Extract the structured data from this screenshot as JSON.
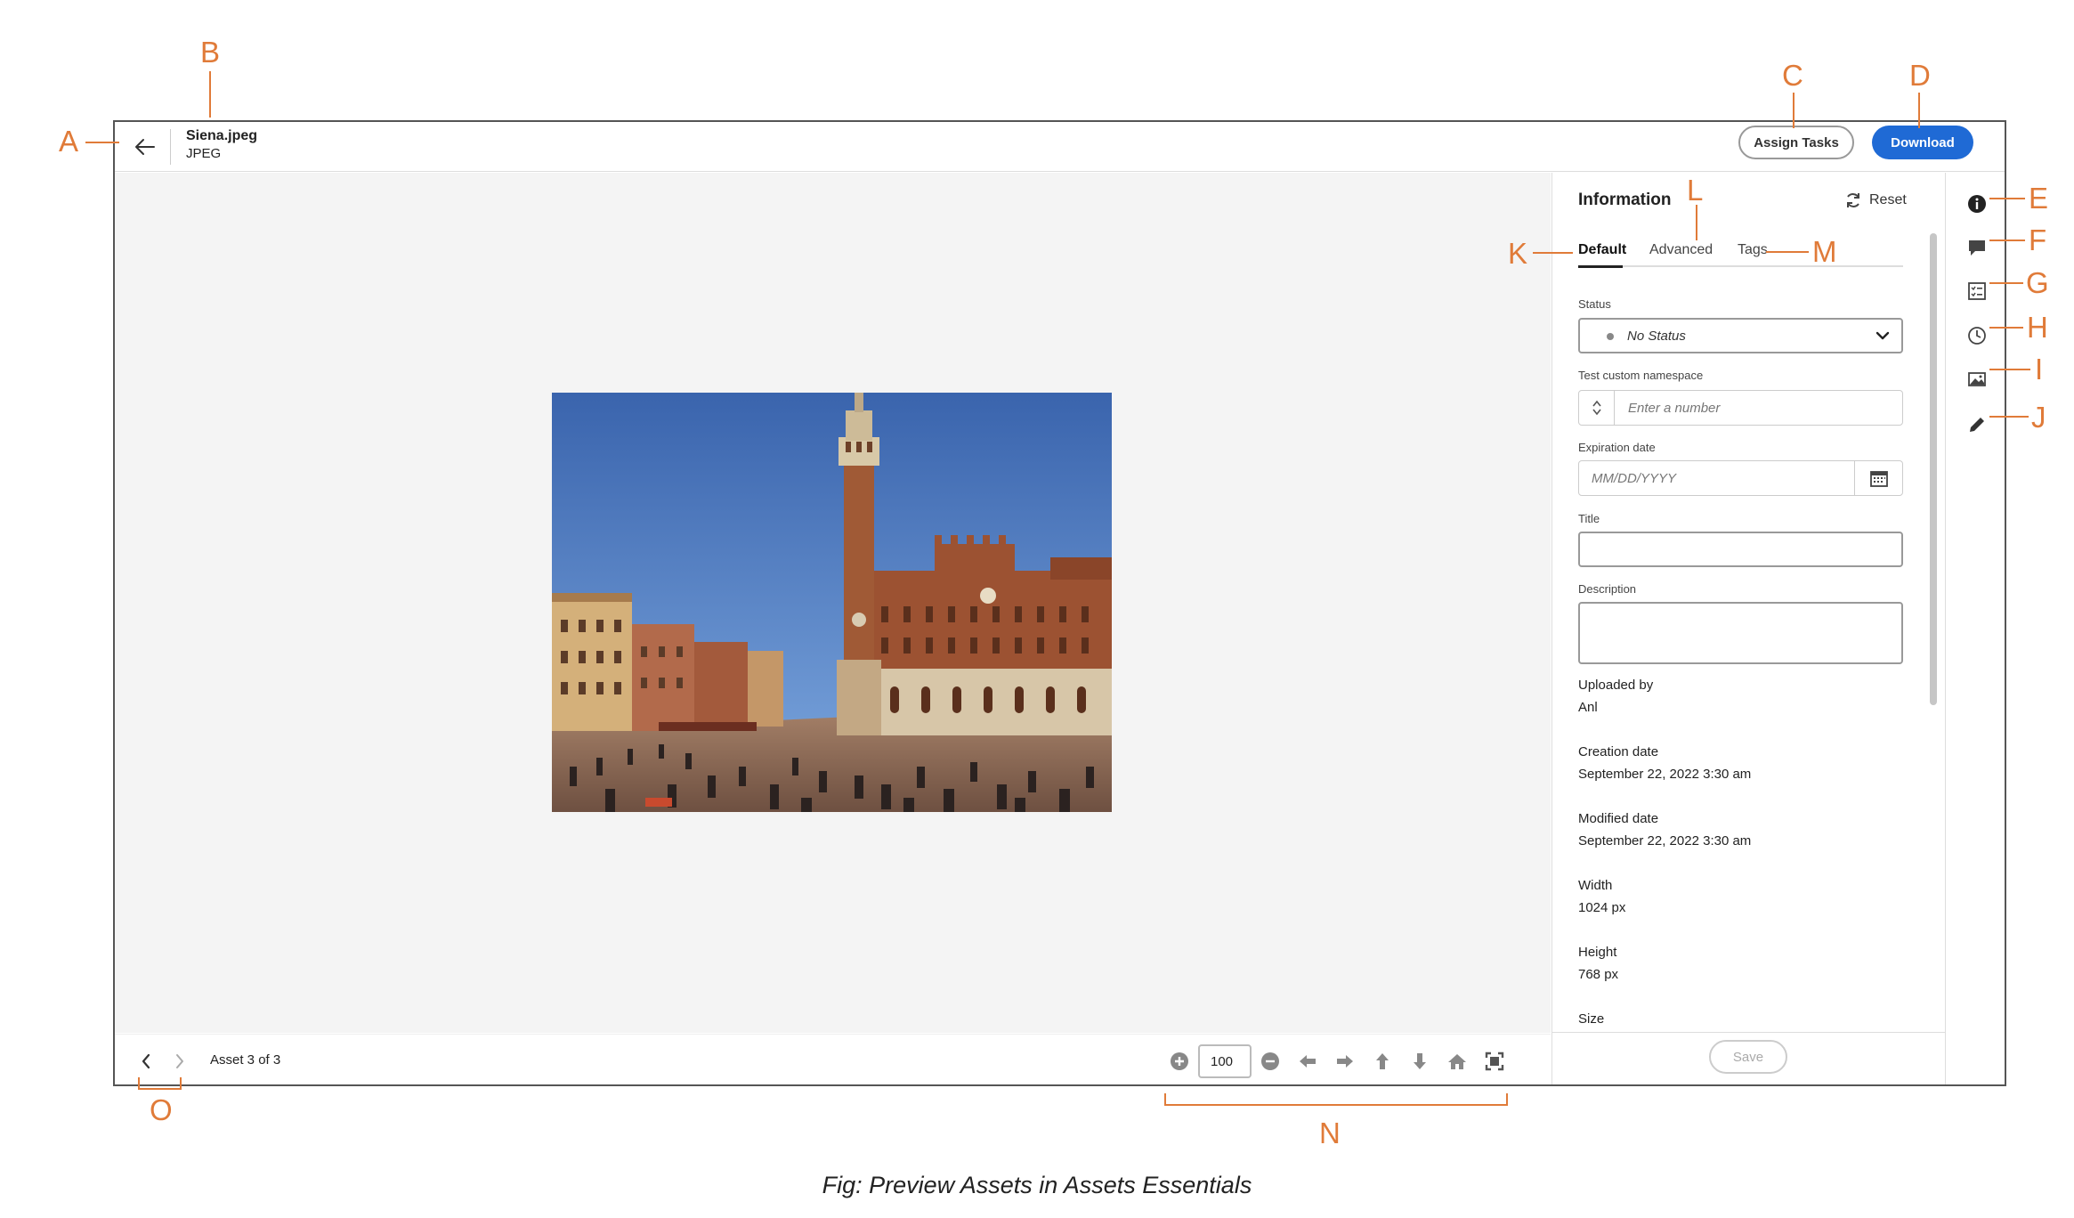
{
  "header": {
    "file_name": "Siena.jpeg",
    "file_type": "JPEG",
    "assign_tasks_label": "Assign Tasks",
    "download_label": "Download"
  },
  "panel": {
    "title": "Information",
    "reset_label": "Reset",
    "tabs": [
      {
        "label": "Default",
        "active": true
      },
      {
        "label": "Advanced",
        "active": false
      },
      {
        "label": "Tags",
        "active": false
      }
    ],
    "status_label": "Status",
    "status_value": "No Status",
    "namespace_label": "Test custom namespace",
    "namespace_placeholder": "Enter a number",
    "expiration_label": "Expiration date",
    "expiration_placeholder": "MM/DD/YYYY",
    "title_label": "Title",
    "description_label": "Description",
    "metadata": [
      {
        "label": "Uploaded by",
        "value": "Anl"
      },
      {
        "label": "Creation date",
        "value": "September 22, 2022 3:30 am"
      },
      {
        "label": "Modified date",
        "value": "September 22, 2022 3:30 am"
      },
      {
        "label": "Width",
        "value": "1024 px"
      },
      {
        "label": "Height",
        "value": "768 px"
      },
      {
        "label": "Size",
        "value": ""
      }
    ],
    "save_label": "Save"
  },
  "footer": {
    "asset_count": "Asset 3 of 3",
    "zoom_value": "100"
  },
  "callouts": [
    "A",
    "B",
    "C",
    "D",
    "E",
    "F",
    "G",
    "H",
    "I",
    "J",
    "K",
    "L",
    "M",
    "N",
    "O"
  ],
  "caption": "Fig: Preview Assets in Assets Essentials",
  "colors": {
    "accent": "#1f6ad5",
    "callout": "#e07b39",
    "preview_bg": "#f4f4f4"
  },
  "icons": [
    "arrow-left-icon",
    "info-icon",
    "comment-icon",
    "tasks-icon",
    "history-icon",
    "renditions-icon",
    "edit-icon",
    "refresh-icon",
    "chevron-down-icon",
    "calendar-icon",
    "zoom-in-icon",
    "zoom-out-icon",
    "pan-left-icon",
    "pan-right-icon",
    "pan-up-icon",
    "pan-down-icon",
    "home-icon",
    "fit-screen-icon"
  ]
}
